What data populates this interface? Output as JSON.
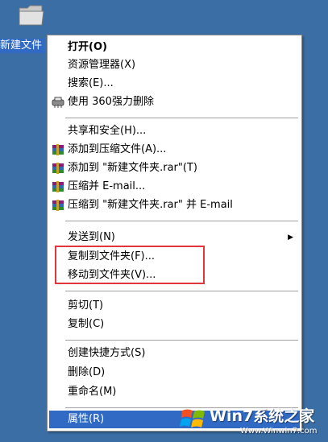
{
  "desktop_icon": {
    "label": "新建文件"
  },
  "menu": {
    "items": [
      {
        "label": "打开(O)",
        "bold": true
      },
      {
        "label": "资源管理器(X)"
      },
      {
        "label": "搜索(E)..."
      },
      {
        "label": "使用 360强力删除",
        "icon": "shredder-icon"
      },
      {
        "label": "共享和安全(H)..."
      },
      {
        "label": "添加到压缩文件(A)...",
        "icon": "winrar-books-icon"
      },
      {
        "label": "添加到 \"新建文件夹.rar\"(T)",
        "icon": "winrar-books-icon"
      },
      {
        "label": "压缩并 E-mail...",
        "icon": "winrar-books-icon"
      },
      {
        "label": "压缩到 \"新建文件夹.rar\" 并 E-mail",
        "icon": "winrar-books-icon"
      },
      {
        "label": "发送到(N)",
        "submenu": true
      },
      {
        "label": "复制到文件夹(F)..."
      },
      {
        "label": "移动到文件夹(V)..."
      },
      {
        "label": "剪切(T)"
      },
      {
        "label": "复制(C)"
      },
      {
        "label": "创建快捷方式(S)"
      },
      {
        "label": "删除(D)"
      },
      {
        "label": "重命名(M)"
      },
      {
        "label": "属性(R)",
        "highlighted": true
      }
    ]
  },
  "watermark": {
    "brand": "Win7系统之家",
    "url": "Www.Winwin7.com"
  },
  "colors": {
    "desktop": "#3a6ea5",
    "highlight": "#316ac5",
    "annotation_box": "#e0373c"
  }
}
